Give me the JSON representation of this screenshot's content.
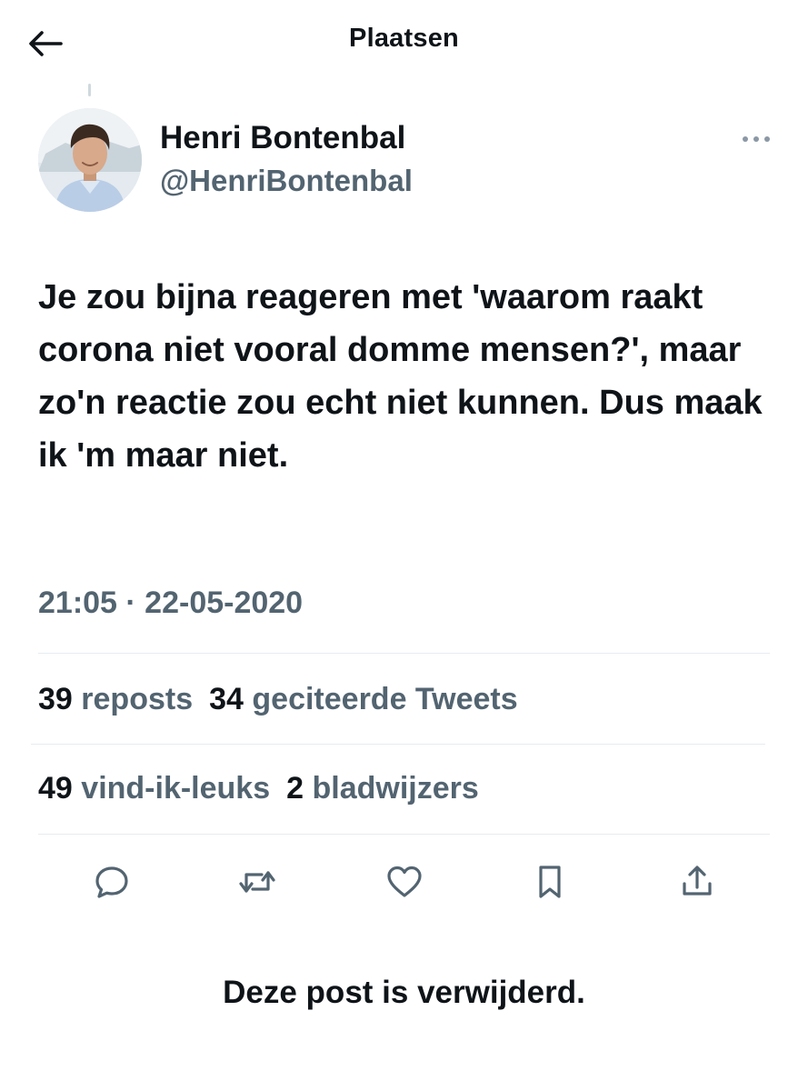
{
  "header": {
    "title": "Plaatsen",
    "back_icon": "arrow-left-icon"
  },
  "author": {
    "name": "Henri Bontenbal",
    "handle": "@HenriBontenbal",
    "more_icon": "more-horizontal-icon"
  },
  "tweet": {
    "text": "Je zou bijna reageren met 'waarom raakt corona niet vooral domme mensen?', maar zo'n reactie zou echt niet kunnen. Dus maak ik 'm maar niet.",
    "timestamp": "21:05 · 22-05-2020"
  },
  "stats": {
    "reposts_count": "39",
    "reposts_label": "reposts",
    "quotes_count": "34",
    "quotes_label": "geciteerde Tweets",
    "likes_count": "49",
    "likes_label": "vind-ik-leuks",
    "bookmarks_count": "2",
    "bookmarks_label": "bladwijzers"
  },
  "actions": [
    "reply-icon",
    "repost-icon",
    "like-icon",
    "bookmark-icon",
    "share-icon"
  ],
  "deleted_notice": "Deze post is verwijderd.",
  "colors": {
    "text": "#0f1419",
    "secondary": "#536471",
    "divider": "#e6ecf0"
  }
}
